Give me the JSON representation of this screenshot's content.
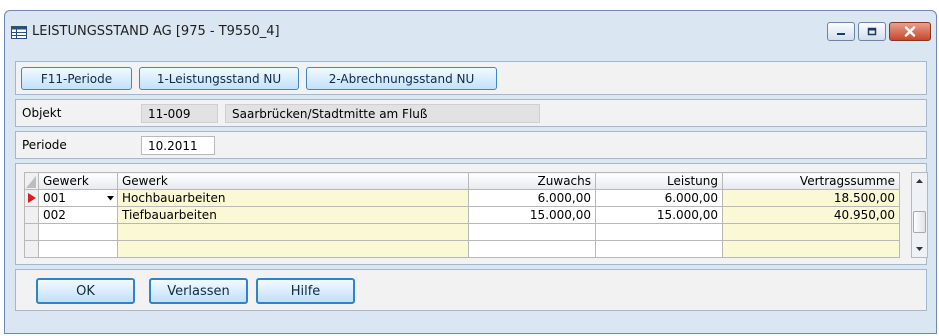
{
  "window": {
    "title": "LEISTUNGSSTAND AG  [975 - T9550_4]"
  },
  "toolbar": {
    "buttons": [
      "F11-Periode",
      "1-Leistungsstand NU",
      "2-Abrechnungsstand NU"
    ]
  },
  "objekt": {
    "label": "Objekt",
    "code": "11-009",
    "name": "Saarbrücken/Stadtmitte am Fluß"
  },
  "periode": {
    "label": "Periode",
    "value": "10.2011"
  },
  "grid": {
    "columns": [
      "Gewerk",
      "Gewerk",
      "Zuwachs",
      "Leistung",
      "Vertragssumme"
    ],
    "rows": [
      [
        "001",
        "Hochbauarbeiten",
        "6.000,00",
        "6.000,00",
        "18.500,00"
      ],
      [
        "002",
        "Tiefbauarbeiten",
        "15.000,00",
        "15.000,00",
        "40.950,00"
      ]
    ]
  },
  "footer": {
    "ok": "OK",
    "verlassen": "Verlassen",
    "hilfe": "Hilfe"
  },
  "colors": {
    "highlight_column": "#fbf8d6",
    "current_row_marker": "#d42020",
    "button_border": "#3d87c7"
  },
  "icons": {
    "window": "table-window-icon",
    "minimize": "minimize-icon",
    "maximize": "maximize-icon",
    "close": "close-icon",
    "row_marker": "row-pointer-icon",
    "dropdown": "dropdown-arrow-icon",
    "scroll_up": "scroll-up-icon",
    "scroll_down": "scroll-down-icon"
  }
}
